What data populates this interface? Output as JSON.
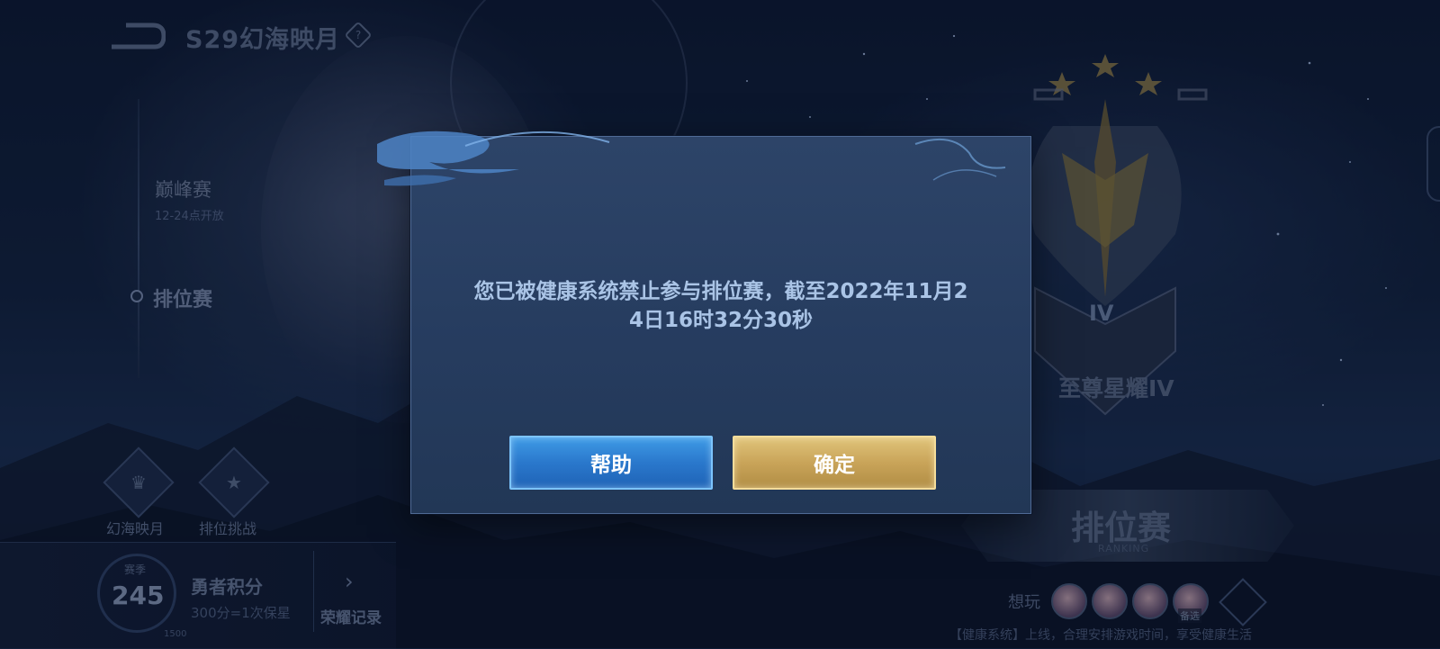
{
  "header": {
    "season_title": "S29幻海映月",
    "help_glyph": "?"
  },
  "modes": {
    "peak": {
      "label": "巅峰赛",
      "sub": "12-24点开放"
    },
    "ranked": {
      "label": "排位赛"
    }
  },
  "bottom_left": {
    "skin_label": "幻海映月",
    "challenge_label": "排位挑战",
    "score": {
      "season": "赛季",
      "value": "245",
      "max": "1500"
    },
    "brave": {
      "label": "勇者积分",
      "sub": "300分=1次保星"
    },
    "record_label": "荣耀记录"
  },
  "rank": {
    "roman": "IV",
    "name": "至尊星耀IV",
    "button_label": "排位赛",
    "button_sub": "RANKING"
  },
  "want_play": {
    "label": "想玩",
    "recommend": "备选"
  },
  "health_notice": "【健康系统】上线，合理安排游戏时间，享受健康生活",
  "modal": {
    "line1": "您已被健康系统禁止参与排位赛，截至2022年11月2",
    "line2": "4日16时32分30秒",
    "help_button": "帮助",
    "ok_button": "确定"
  },
  "colors": {
    "help_blue": "#2a78cc",
    "ok_gold": "#c9a459",
    "message": "#aac4e6"
  }
}
